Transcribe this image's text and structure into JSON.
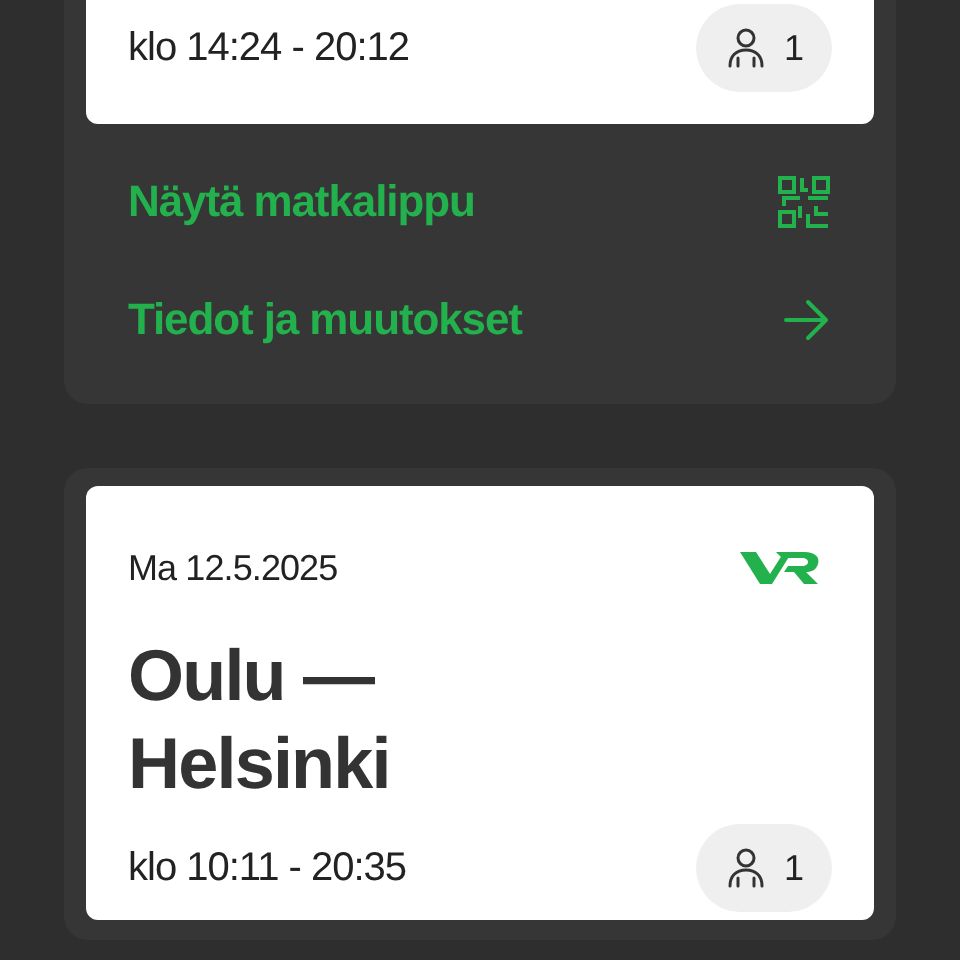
{
  "trips": [
    {
      "time": "klo 14:24 - 20:12",
      "passengers": "1",
      "actions": [
        {
          "label": "Näytä matkalippu",
          "kind": "qr"
        },
        {
          "label": "Tiedot ja muutokset",
          "kind": "arrow"
        }
      ]
    },
    {
      "date": "Ma 12.5.2025",
      "route": "Oulu — Helsinki",
      "time": "klo 10:11 - 20:35",
      "passengers": "1"
    }
  ]
}
